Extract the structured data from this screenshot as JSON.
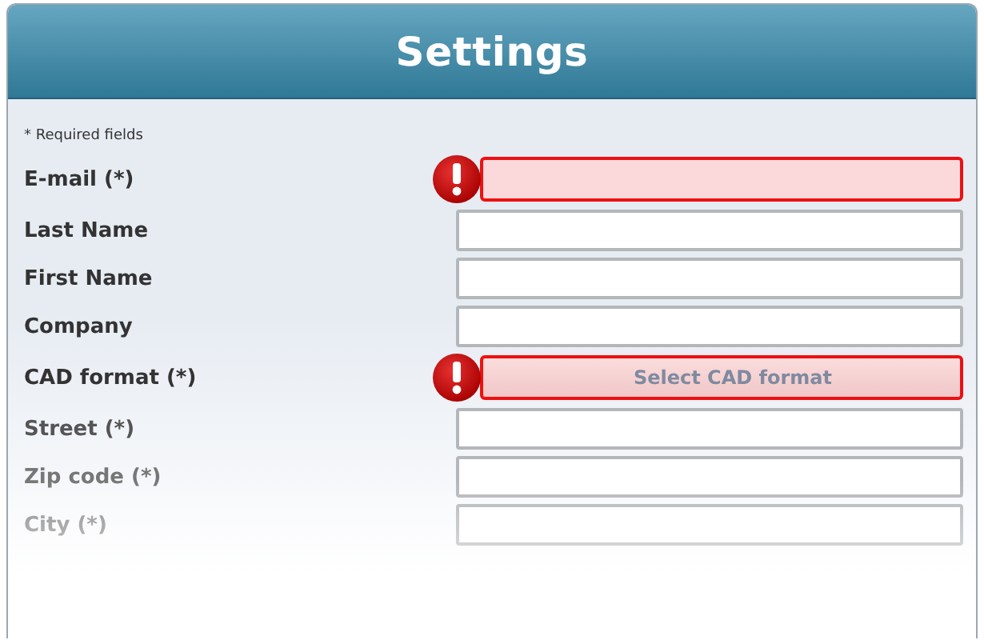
{
  "window": {
    "title": "Settings"
  },
  "note": "* Required fields",
  "fields": [
    {
      "label": "E-mail (*)",
      "kind": "text",
      "error": true
    },
    {
      "label": "Last Name",
      "kind": "text",
      "error": false
    },
    {
      "label": "First Name",
      "kind": "text",
      "error": false
    },
    {
      "label": "Company",
      "kind": "text",
      "error": false
    },
    {
      "label": "CAD format (*)",
      "kind": "select",
      "error": true,
      "placeholder": "Select CAD format"
    },
    {
      "label": "Street (*)",
      "kind": "text",
      "error": false
    },
    {
      "label": "Zip code (*)",
      "kind": "text",
      "error": false
    },
    {
      "label": "City (*)",
      "kind": "text",
      "error": false
    }
  ]
}
